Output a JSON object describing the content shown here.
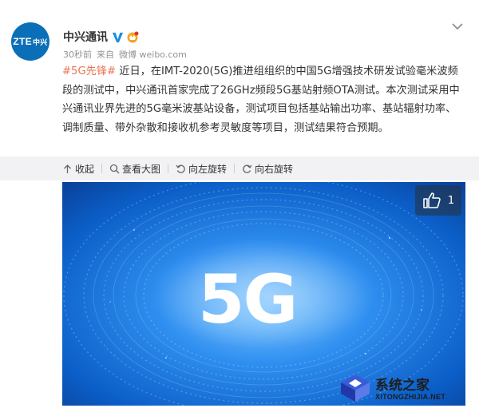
{
  "account": {
    "avatar_text": "ZTE",
    "avatar_subtext": "中兴",
    "name": "中兴通讯",
    "time": "30秒前",
    "source_prefix": "来自",
    "source": "微博 weibo.com"
  },
  "post": {
    "hashtag": "#5G先锋#",
    "text": " 近日，在IMT-2020(5G)推进组组织的中国5G增强技术研发试验毫米波频段的测试中，中兴通讯首家完成了26GHz频段5G基站射频OTA测试。本次测试采用中兴通讯业界先进的5G毫米波基站设备，测试项目包括基站输出功率、基站辐射功率、调制质量、带外杂散和接收机参考灵敏度等项目，测试结果符合预期。"
  },
  "actions": {
    "collapse": "收起",
    "view_large": "查看大图",
    "rotate_left": "向左旋转",
    "rotate_right": "向右旋转"
  },
  "image": {
    "headline": "5G",
    "like_count": "1"
  },
  "watermark": {
    "title": "系统之家",
    "url": "XITONGZHIJIA.NET"
  },
  "colors": {
    "hashtag": "#eb7350",
    "action_bar_bg": "#f2f2f5",
    "avatar_bg": "#0b6fb8"
  }
}
